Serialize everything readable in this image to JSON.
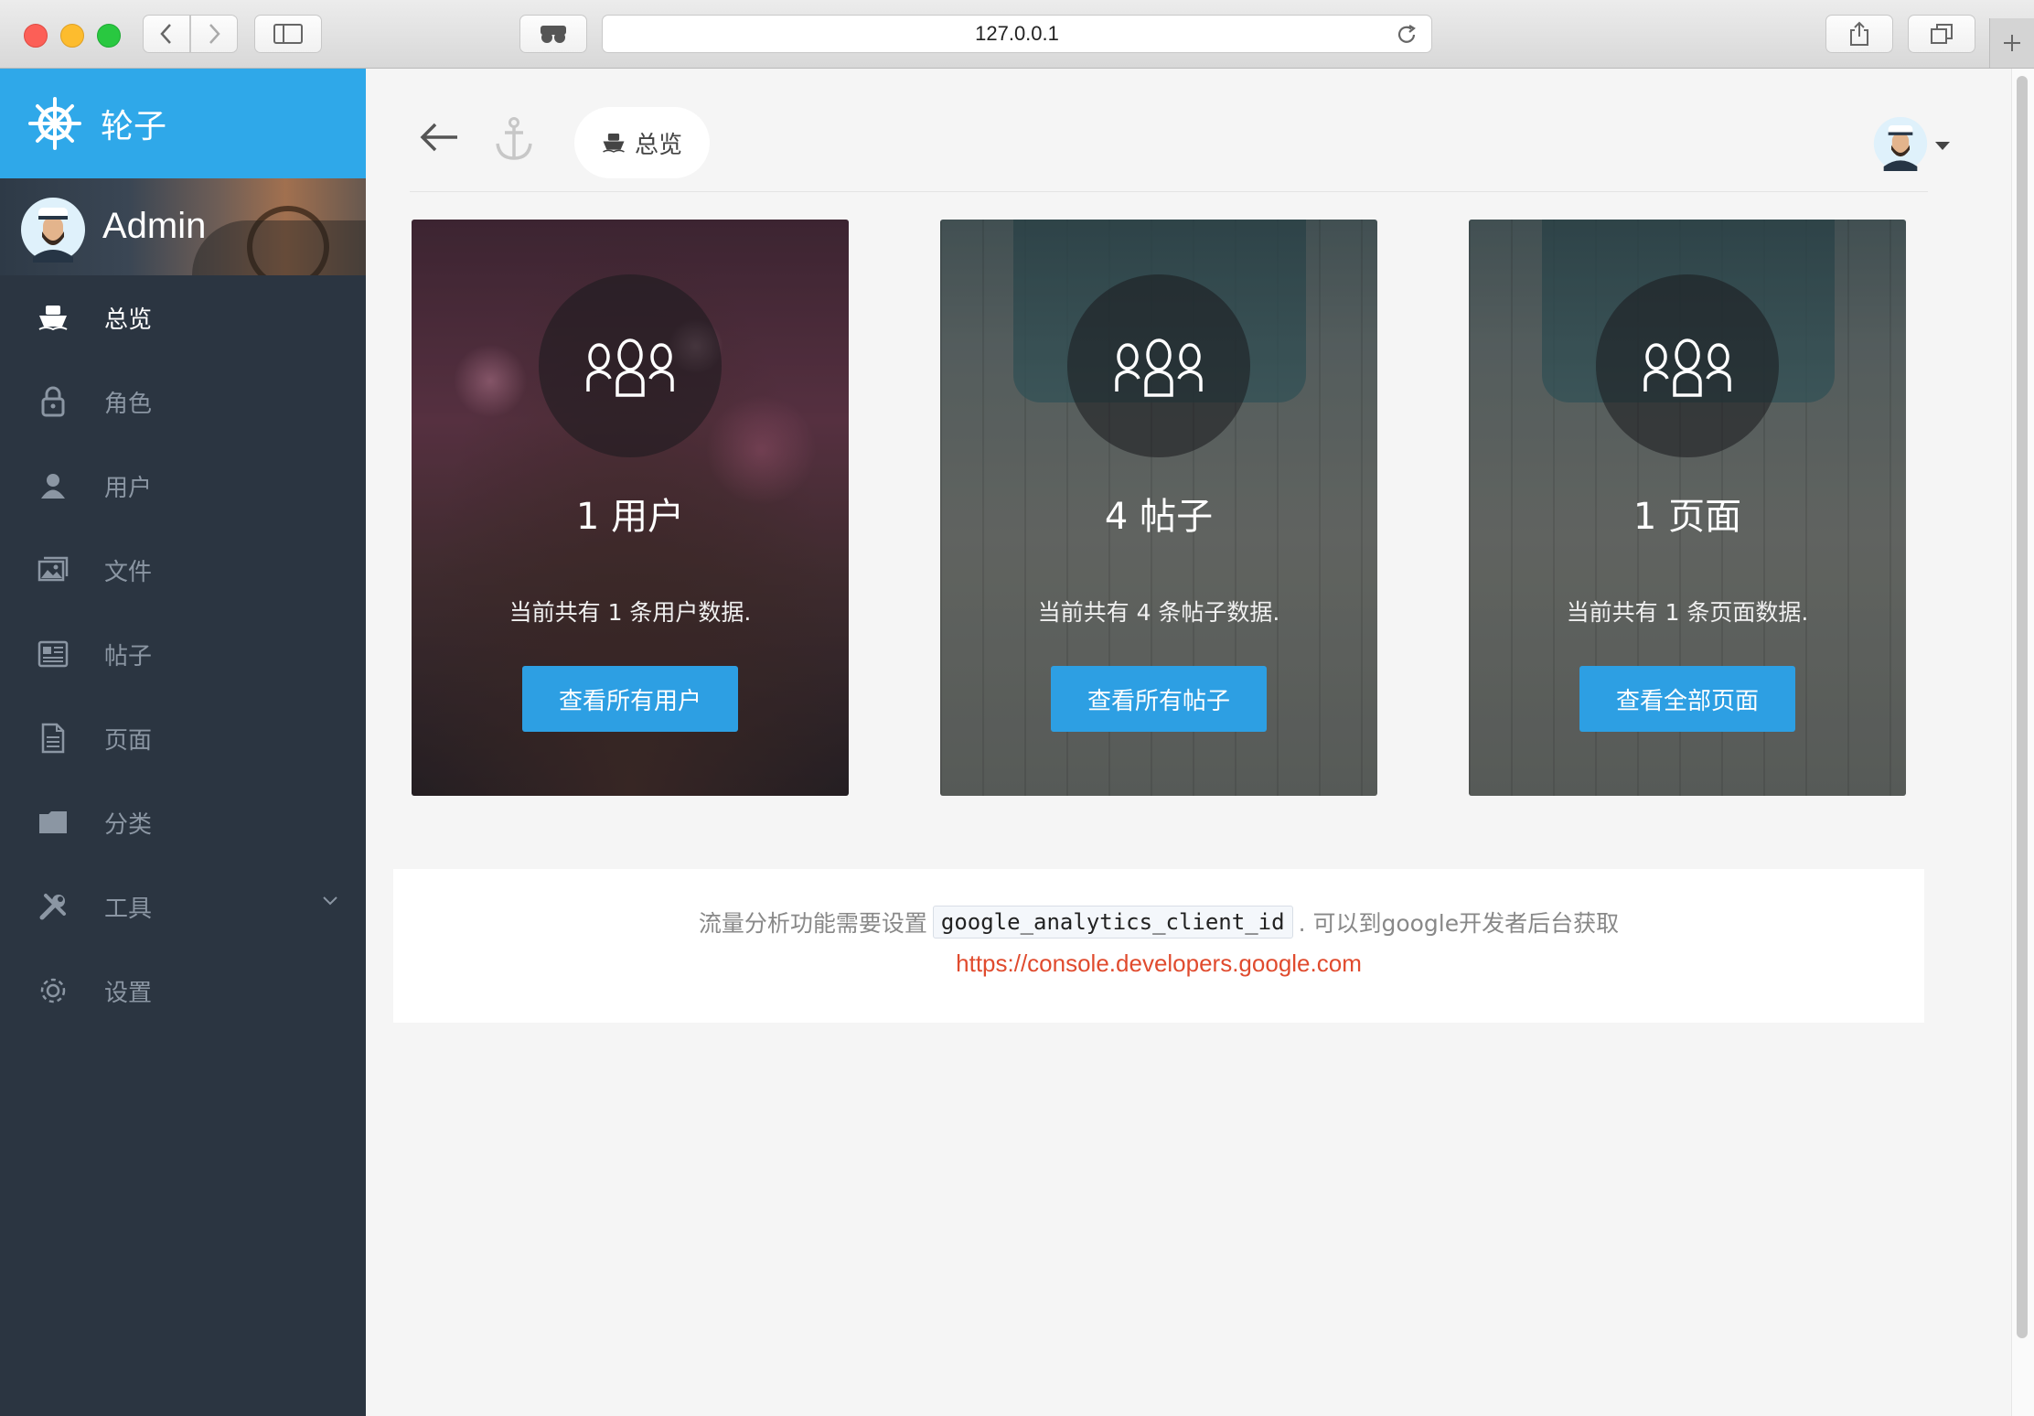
{
  "browser": {
    "url": "127.0.0.1"
  },
  "brand": {
    "title": "轮子"
  },
  "user": {
    "name": "Admin"
  },
  "sidebar": {
    "items": [
      {
        "label": "总览",
        "icon": "ship-icon",
        "active": true
      },
      {
        "label": "角色",
        "icon": "lock-icon"
      },
      {
        "label": "用户",
        "icon": "user-icon"
      },
      {
        "label": "文件",
        "icon": "image-icon"
      },
      {
        "label": "帖子",
        "icon": "newspaper-icon"
      },
      {
        "label": "页面",
        "icon": "file-icon"
      },
      {
        "label": "分类",
        "icon": "folder-icon"
      },
      {
        "label": "工具",
        "icon": "tools-icon",
        "has_submenu": true
      },
      {
        "label": "设置",
        "icon": "gear-icon"
      }
    ]
  },
  "breadcrumb": {
    "label": "总览"
  },
  "cards": [
    {
      "count": "1 用户",
      "description": "当前共有 1 条用户数据.",
      "button": "查看所有用户"
    },
    {
      "count": "4 帖子",
      "description": "当前共有 4 条帖子数据.",
      "button": "查看所有帖子"
    },
    {
      "count": "1 页面",
      "description": "当前共有 1 条页面数据.",
      "button": "查看全部页面"
    }
  ],
  "analytics": {
    "text_before": "流量分析功能需要设置",
    "code": "google_analytics_client_id",
    "text_after": ". 可以到google开发者后台获取",
    "link": "https://console.developers.google.com"
  },
  "colors": {
    "brand": "#2fa8e9",
    "sidebar": "#2b3541",
    "button": "#2d9fe3",
    "link": "#e04b2e"
  }
}
